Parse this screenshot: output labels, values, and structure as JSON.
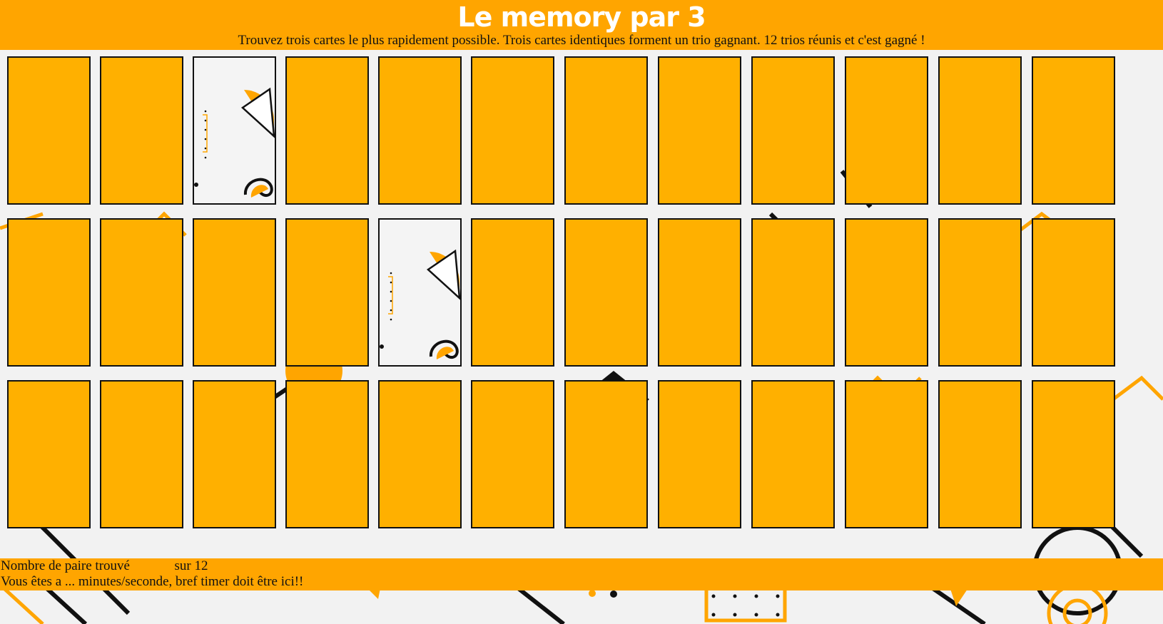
{
  "header": {
    "title": "Le memory par 3",
    "subtitle": "Trouvez trois cartes le plus rapidement possible. Trois cartes identiques forment un trio gagnant. 12 trios réunis et c'est gagné !"
  },
  "board": {
    "rows": [
      {
        "cards": [
          {
            "state": "hidden"
          },
          {
            "state": "hidden"
          },
          {
            "state": "revealed",
            "face": "abstract-shapes-icon"
          },
          {
            "state": "hidden"
          },
          {
            "state": "hidden"
          },
          {
            "state": "hidden"
          },
          {
            "state": "hidden"
          },
          {
            "state": "hidden"
          },
          {
            "state": "hidden"
          },
          {
            "state": "hidden"
          },
          {
            "state": "hidden"
          },
          {
            "state": "hidden"
          }
        ]
      },
      {
        "cards": [
          {
            "state": "hidden"
          },
          {
            "state": "hidden"
          },
          {
            "state": "hidden"
          },
          {
            "state": "hidden"
          },
          {
            "state": "revealed",
            "face": "abstract-shapes-icon"
          },
          {
            "state": "hidden"
          },
          {
            "state": "hidden"
          },
          {
            "state": "hidden"
          },
          {
            "state": "hidden"
          },
          {
            "state": "hidden"
          },
          {
            "state": "hidden"
          },
          {
            "state": "hidden"
          }
        ]
      },
      {
        "cards": [
          {
            "state": "hidden"
          },
          {
            "state": "hidden"
          },
          {
            "state": "hidden"
          },
          {
            "state": "hidden"
          },
          {
            "state": "hidden"
          },
          {
            "state": "hidden"
          },
          {
            "state": "hidden"
          },
          {
            "state": "hidden"
          },
          {
            "state": "hidden"
          },
          {
            "state": "hidden"
          },
          {
            "state": "hidden"
          },
          {
            "state": "hidden"
          }
        ]
      }
    ]
  },
  "footer": {
    "score_label": "Nombre de paire trouvé",
    "score_count": "",
    "score_total_label": "sur 12",
    "timer_text": "Vous êtes a ... minutes/seconde, bref timer doit être ici!!"
  },
  "colors": {
    "accent": "#ffa500",
    "card_back": "#ffb000",
    "card_border": "#111111",
    "background": "#f2f2f2"
  }
}
